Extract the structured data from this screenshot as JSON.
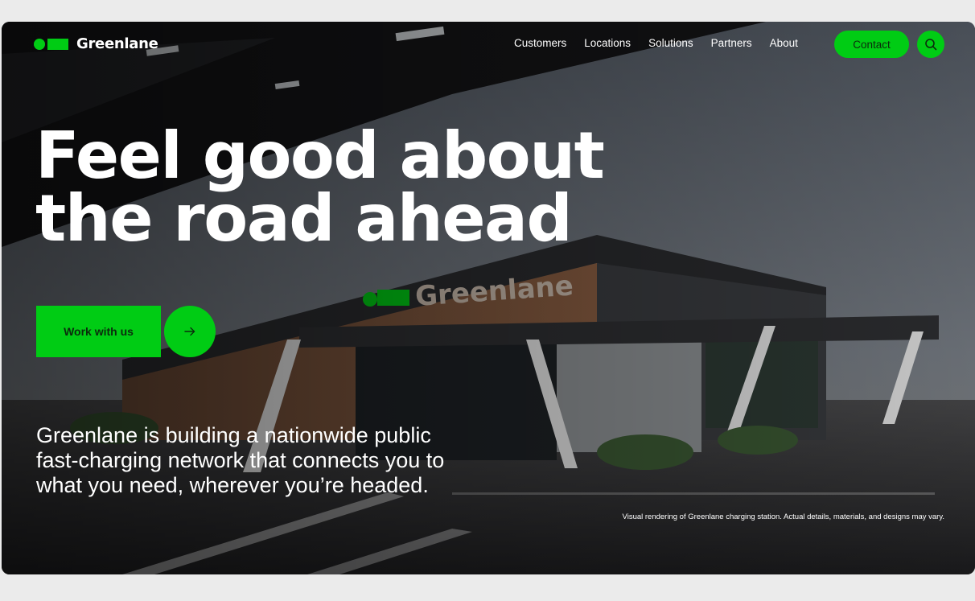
{
  "brand": {
    "name": "Greenlane",
    "accent": "#00cc14"
  },
  "nav": {
    "items": [
      {
        "label": "Customers"
      },
      {
        "label": "Locations"
      },
      {
        "label": "Solutions"
      },
      {
        "label": "Partners"
      },
      {
        "label": "About"
      }
    ],
    "contact_label": "Contact",
    "search_icon": "search-icon"
  },
  "hero": {
    "headline_line1": "Feel good about",
    "headline_line2": "the road ahead",
    "cta_label": "Work with us",
    "cta_icon": "arrow-right-icon",
    "intro": "Greenlane is building a nationwide public fast-charging network that connects you to what you need, wherever you’re headed.",
    "disclaimer": "Visual rendering of Greenlane charging station. Actual details, materials, and designs may vary.",
    "building_sign": "Greenlane"
  }
}
